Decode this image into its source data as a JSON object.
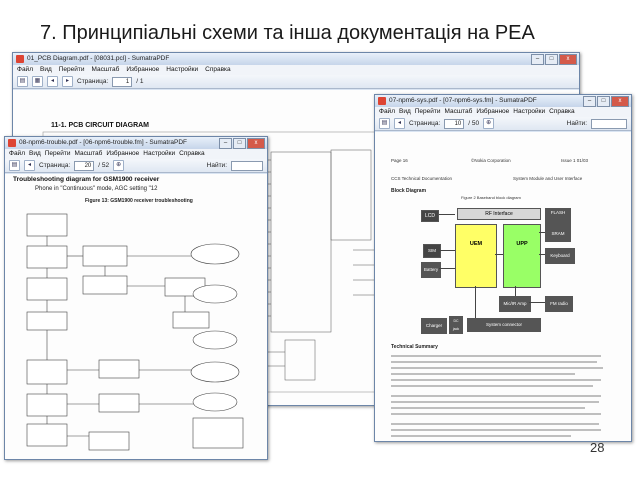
{
  "slide": {
    "title": "7. Принципіальні схеми та інша документація на РЕА",
    "page_number": "28"
  },
  "win_pcb": {
    "title": "01_PCB Diagram.pdf - [08031.pcl] - SumatraPDF",
    "menu": [
      "Файл",
      "Вид",
      "Перейти",
      "Масштаб",
      "Избранное",
      "Настройки",
      "Справка"
    ],
    "page_label": "Страница:",
    "page_value": "1",
    "page_total": "/ 1",
    "heading": "11-1. PCB CIRCUIT DIAGRAM"
  },
  "win_trouble": {
    "title": "08-npm6-trouble.pdf - [06-npm6-trouble.fm] - SumatraPDF",
    "menu": [
      "Файл",
      "Вид",
      "Перейти",
      "Масштаб",
      "Избранное",
      "Настройки",
      "Справка"
    ],
    "page_label": "Страница:",
    "page_value": "20",
    "page_total": "/ 52",
    "find_label": "Найти:",
    "heading": "Troubleshooting diagram for GSM1900 receiver",
    "subheading": "Phone in \"Continuous\" mode, AGC setting \"12",
    "figure": "Figure 13: GSM1900 receiver troubleshooting"
  },
  "win_sys": {
    "title": "07-npm6-sys.pdf - [07-npm6-sys.fm] - SumatraPDF",
    "menu": [
      "Файл",
      "Вид",
      "Перейти",
      "Масштаб",
      "Избранное",
      "Настройки",
      "Справка"
    ],
    "page_label": "Страница:",
    "page_value": "10",
    "page_total": "/ 50",
    "find_label": "Найти:",
    "header_left": "Page 16",
    "header_mid": "©Nokia Corporation",
    "header_right": "Issue 1 01/03",
    "doc_line_left": "CCS Technical Documentation",
    "doc_line_right": "System Module and User Interface",
    "block_heading": "Block Diagram",
    "figure": "Figure 2 Baseband block diagram",
    "blocks": {
      "rf_interface": "RF Interface",
      "lcd": "LCD",
      "flash": "FLASH",
      "sram": "SRAM",
      "sim": "SIM",
      "ueme": "UEM",
      "upp": "UPP",
      "battery": "Battery",
      "keyboard": "Keyboard",
      "charger": "Charger",
      "mic_amp": "Mic/IR Amp",
      "fm_radio": "FM radio",
      "system_connector": "System connector",
      "dc_jack": "DC jack"
    },
    "section_heading": "Technical Summary"
  }
}
